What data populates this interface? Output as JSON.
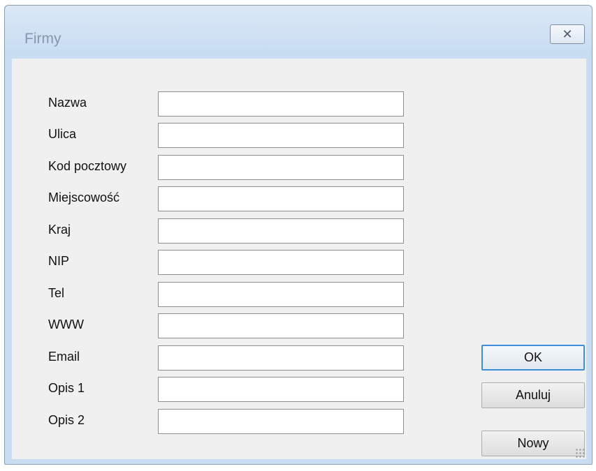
{
  "window": {
    "title": "Firmy",
    "close_icon": "✕"
  },
  "form": {
    "fields": [
      {
        "label": "Nazwa",
        "value": ""
      },
      {
        "label": "Ulica",
        "value": ""
      },
      {
        "label": "Kod pocztowy",
        "value": ""
      },
      {
        "label": "Miejscowość",
        "value": ""
      },
      {
        "label": "Kraj",
        "value": ""
      },
      {
        "label": "NIP",
        "value": ""
      },
      {
        "label": "Tel",
        "value": ""
      },
      {
        "label": "WWW",
        "value": ""
      },
      {
        "label": "Email",
        "value": ""
      },
      {
        "label": "Opis 1",
        "value": ""
      },
      {
        "label": "Opis 2",
        "value": ""
      }
    ]
  },
  "buttons": {
    "ok": "OK",
    "cancel": "Anuluj",
    "new": "Nowy"
  }
}
